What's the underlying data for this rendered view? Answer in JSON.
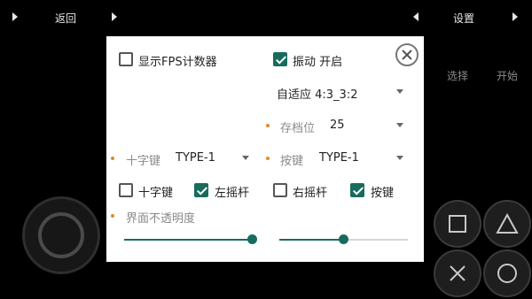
{
  "topbar": {
    "back_label": "返回",
    "settings_label": "设置"
  },
  "side_buttons": {
    "select_label": "选择",
    "start_label": "开始"
  },
  "dialog": {
    "fps_counter": {
      "label": "显示FPS计数器",
      "checked": false
    },
    "vibration": {
      "label": "振动 开启",
      "checked": true
    },
    "aspect_ratio": {
      "value": "自适应 4:3_3:2"
    },
    "save_slot": {
      "label": "存档位",
      "value": "25"
    },
    "dpad_type": {
      "label": "十字键",
      "value": "TYPE-1"
    },
    "button_type": {
      "label": "按键",
      "value": "TYPE-1"
    },
    "visibility": [
      {
        "label": "十字键",
        "checked": false
      },
      {
        "label": "左摇杆",
        "checked": true
      },
      {
        "label": "右摇杆",
        "checked": false
      },
      {
        "label": "按键",
        "checked": true
      }
    ],
    "opacity": {
      "label": "界面不透明度",
      "slider1_level": 1.0,
      "slider2_level": 0.5
    }
  },
  "colors": {
    "accent": "#176c5e",
    "marker": "#e08a2c",
    "background": "#000000"
  },
  "icons": [
    "chevron-right-icon",
    "chevron-left-icon",
    "close-icon",
    "square-icon",
    "triangle-icon",
    "cross-icon",
    "circle-icon"
  ]
}
